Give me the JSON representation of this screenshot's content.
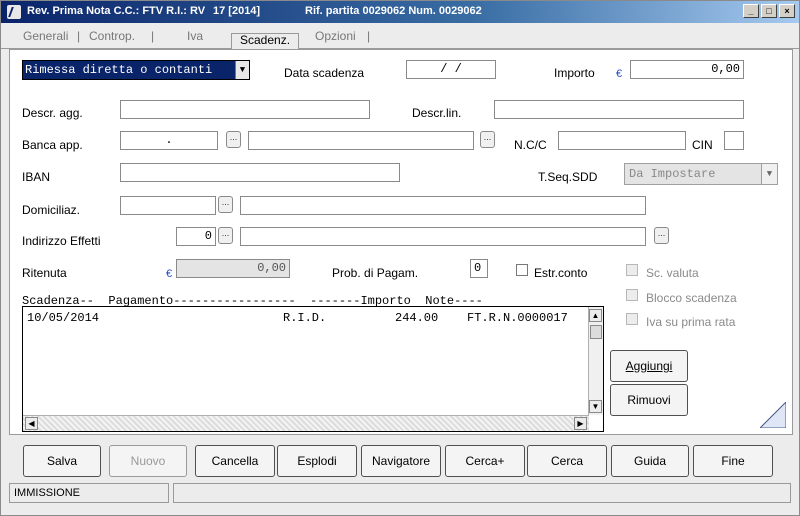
{
  "window": {
    "title_main": "Rev. Prima Nota C.C.: FTV  R.I.: RV",
    "title_num": "17 [2014]",
    "title_ref": "Rif. partita 0029062 Num. 0029062",
    "min_icon": "_",
    "max_icon": "□",
    "close_icon": "×"
  },
  "tabs": [
    {
      "label": "Generali"
    },
    {
      "label": "Controp."
    },
    {
      "label": "Iva"
    },
    {
      "label": "Scadenz."
    },
    {
      "label": "Opzioni"
    }
  ],
  "tab_sep": "|",
  "form": {
    "payment_type": "Rimessa diretta o contanti",
    "data_scadenza_label": "Data scadenza",
    "data_scadenza_value": "/  /",
    "importo_label": "Importo",
    "importo_value": "0,00",
    "currency": "€",
    "descr_agg_label": "Descr. agg.",
    "descr_lin_label": "Descr.lin.",
    "banca_app_label": "Banca app.",
    "banca_app_value": ".",
    "ncc_label": "N.C/C",
    "cin_label": "CIN",
    "iban_label": "IBAN",
    "tseq_label": "T.Seq.SDD",
    "tseq_value": "Da Impostare",
    "domiciliaz_label": "Domiciliaz.",
    "indirizzo_label": "Indirizzo Effetti",
    "indirizzo_value": "0",
    "ritenuta_label": "Ritenuta",
    "ritenuta_value": "0,00",
    "prob_label": "Prob. di Pagam.",
    "prob_value": "0",
    "estr_label": "Estr.conto",
    "sc_valuta_label": "Sc. valuta",
    "blocco_label": "Blocco scadenza",
    "iva_prima_label": "Iva su prima rata",
    "ellipsis": "..."
  },
  "list": {
    "header": "Scadenza--  Pagamento-----------------  -------Importo  Note----",
    "rows": [
      {
        "scadenza": "10/05/2014",
        "pagamento": "R.I.D.",
        "importo": "244.00",
        "note": "FT.R.N.0000017"
      }
    ],
    "up_arrow": "▲",
    "down_arrow": "▼",
    "left_arrow": "◀",
    "right_arrow": "▶"
  },
  "actions": {
    "aggiungi": "Aggiungi",
    "rimuovi": "Rimuovi"
  },
  "toolbar": [
    {
      "label": "Salva",
      "enabled": true
    },
    {
      "label": "Nuovo",
      "enabled": false
    },
    {
      "label": "Cancella",
      "enabled": true
    },
    {
      "label": "Esplodi",
      "enabled": true
    },
    {
      "label": "Navigatore",
      "enabled": true
    },
    {
      "label": "Cerca+",
      "enabled": true
    },
    {
      "label": "Cerca",
      "enabled": true
    },
    {
      "label": "Guida",
      "enabled": true
    },
    {
      "label": "Fine",
      "enabled": true
    }
  ],
  "status": {
    "mode": "IMMISSIONE",
    "message": ""
  },
  "colors": {
    "title_bar": "#0a246a",
    "selection": "#0a246a",
    "currency_blue": "#2848c8"
  }
}
